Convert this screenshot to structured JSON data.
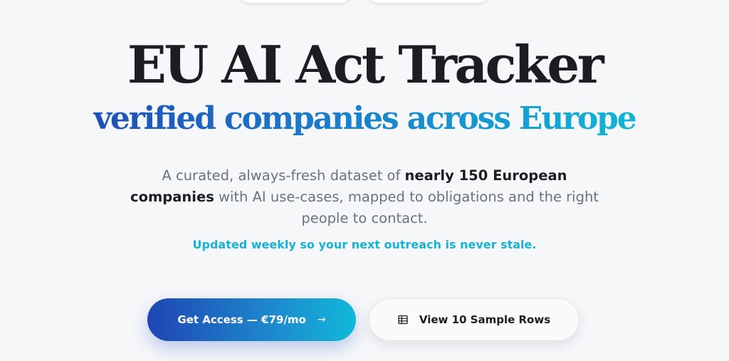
{
  "hero": {
    "title": "EU AI Act Tracker",
    "subtitle": "verified companies across Europe"
  },
  "description": {
    "part1": "A curated, always-fresh dataset of ",
    "bold1": "nearly 150 European companies",
    "part2": " with AI use-cases, mapped to obligations and the right people to contact."
  },
  "update_note": "Updated weekly so your next outreach is never stale.",
  "cta": {
    "primary_label": "Get Access — €79/mo",
    "primary_icon": "arrow-right-icon",
    "secondary_label": "View 10 Sample Rows",
    "secondary_icon": "table-icon"
  },
  "colors": {
    "background": "#f6f7f9",
    "title": "#1c1d22",
    "accent_start": "#1e45b4",
    "accent_end": "#11b8d8",
    "note": "#17b3d4"
  }
}
